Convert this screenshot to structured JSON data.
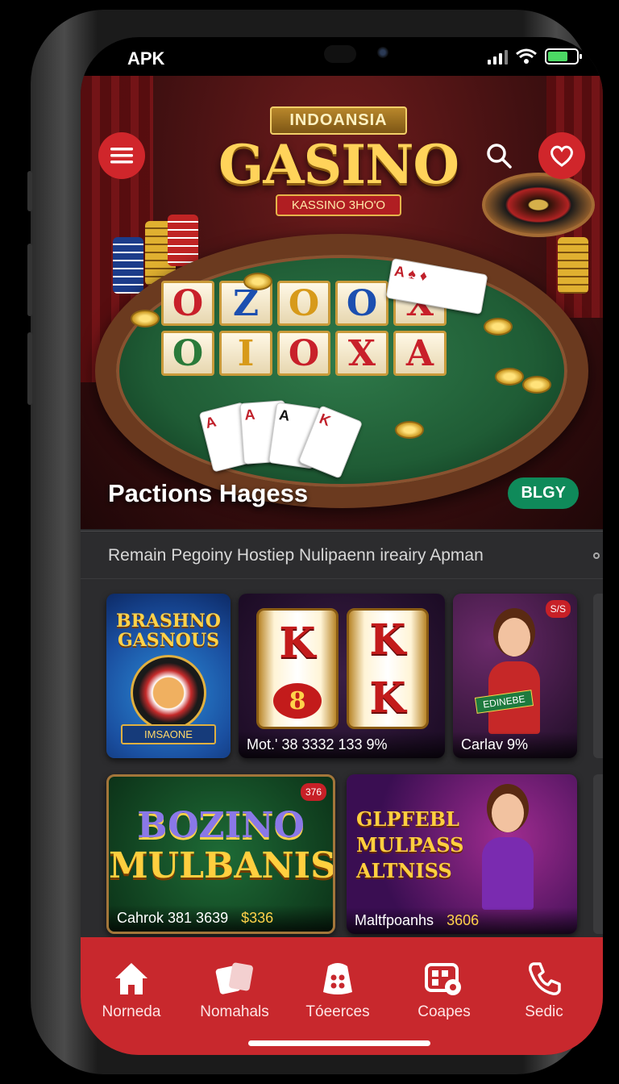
{
  "status_bar": {
    "label": "APK",
    "battery_fraction": 0.7
  },
  "hero": {
    "logo_top": "INDOANSIA",
    "logo_main": "GASINO",
    "logo_sub": "KASSINO 3HO'O",
    "reels": [
      "O",
      "Z",
      "O",
      "O",
      "X",
      "O",
      "I",
      "O",
      "X",
      "A"
    ],
    "title": "Pactions Hagess",
    "badge": "BLGY"
  },
  "subtitle": "Remain Pegoiny Hostiep Nulipaenn ireairy Apman",
  "games": [
    {
      "title": "BRASHNO GASNOUS",
      "ribbon": "IMSAONE",
      "caption": ""
    },
    {
      "reel_top": [
        "K",
        "K"
      ],
      "reel_bottom": [
        "8",
        "K"
      ],
      "caption": "Mot.' 38 3332  133 9%"
    },
    {
      "corner": "S/S",
      "sash": "EDINEBE",
      "caption": "Carlav 9%"
    },
    {
      "title_a": "BOZINO",
      "title_b": "MULBANIS",
      "corner": "376",
      "caption_left": "Cahrok  381 3639",
      "caption_right": "$336"
    },
    {
      "title_a": "GLPFEBL",
      "title_b": "MULPASS",
      "title_c": "ALTNISS",
      "caption_left": "Maltfpoanhs",
      "caption_right": "3606"
    }
  ],
  "tabbar": {
    "items": [
      {
        "label": "Norneda",
        "icon": "home-icon"
      },
      {
        "label": "Nomahals",
        "icon": "cards-icon"
      },
      {
        "label": "Tóeerces",
        "icon": "dice-icon"
      },
      {
        "label": "Coapes",
        "icon": "coupon-icon"
      },
      {
        "label": "Sedic",
        "icon": "phone-icon"
      }
    ]
  },
  "colors": {
    "accent": "#c8282d",
    "badge": "#0f8a5a",
    "gold": "#ffd35a"
  }
}
